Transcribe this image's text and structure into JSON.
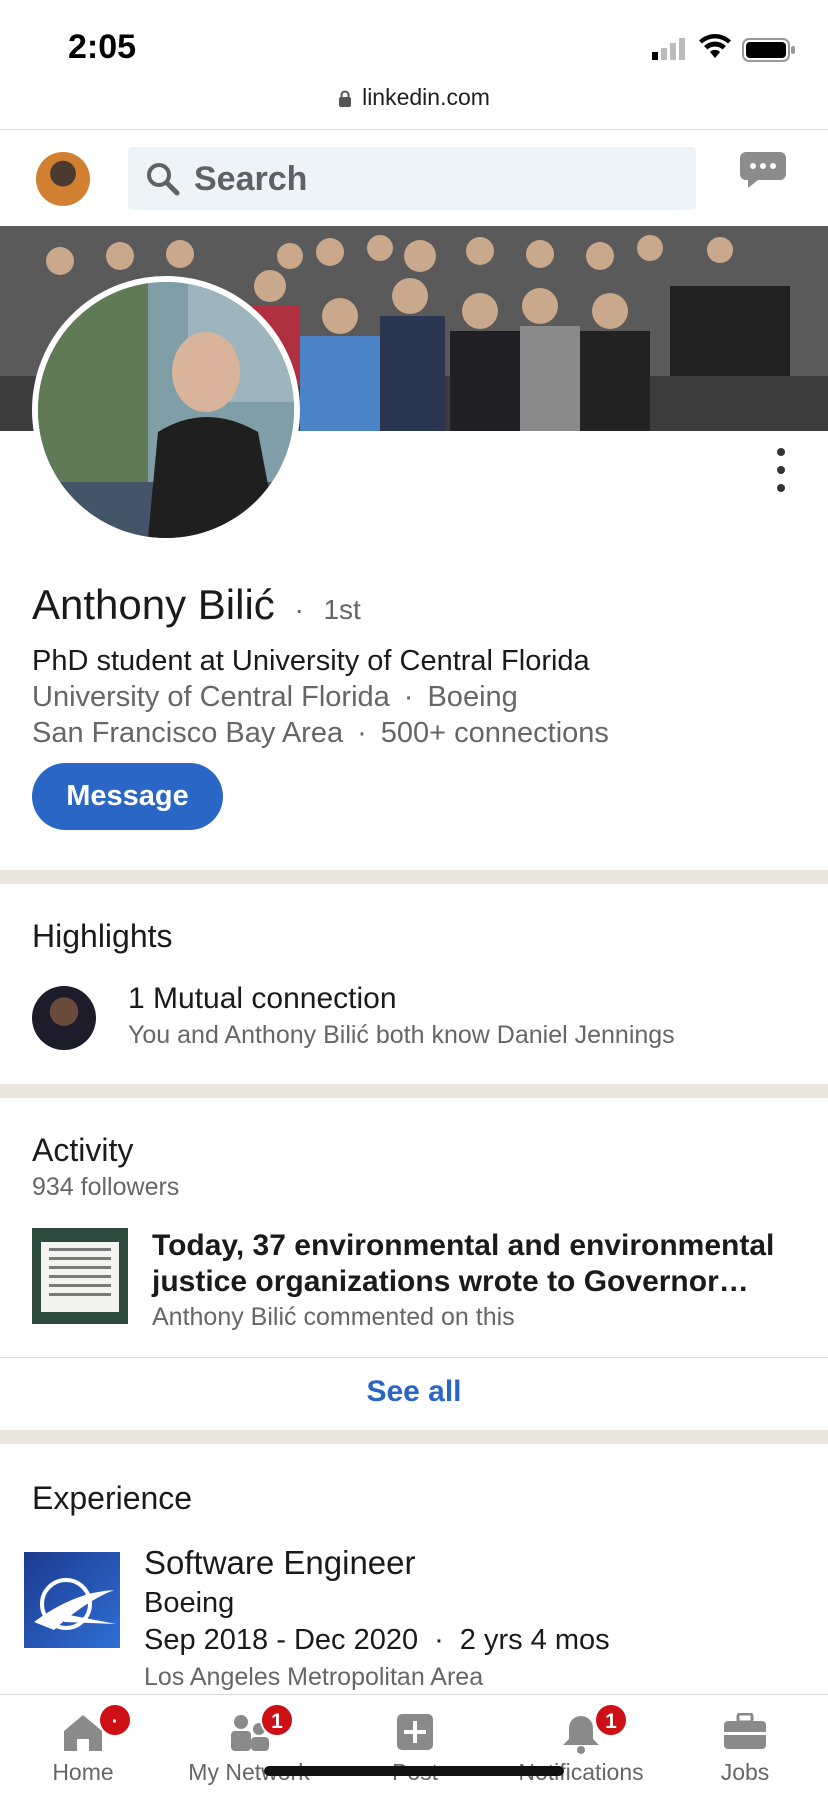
{
  "status_bar": {
    "time": "2:05",
    "url": "linkedin.com"
  },
  "top_nav": {
    "search_placeholder": "Search"
  },
  "profile": {
    "name": "Anthony Bilić",
    "degree_separator": "·",
    "degree": "1st",
    "headline": "PhD student at University of Central Florida",
    "education": "University of Central Florida",
    "company": "Boeing",
    "location": "San Francisco Bay Area",
    "connections": "500+ connections",
    "dot": "·",
    "message_button": "Message"
  },
  "highlights": {
    "title": "Highlights",
    "mutual_title": "1 Mutual connection",
    "mutual_sub": "You and Anthony Bilić both know Daniel Jennings"
  },
  "activity": {
    "title": "Activity",
    "followers": "934 followers",
    "post_title": "Today, 37 environmental and environmental justice organizations wrote to Governor…",
    "post_sub": "Anthony Bilić commented on this",
    "see_all": "See all"
  },
  "experience": {
    "title": "Experience",
    "role": "Software Engineer",
    "company": "Boeing",
    "dates": "Sep 2018 - Dec 2020",
    "duration": "2 yrs 4 mos",
    "location": "Los Angeles Metropolitan Area"
  },
  "tabs": [
    {
      "label": "Home",
      "badge": "·"
    },
    {
      "label": "My Network",
      "badge": "1"
    },
    {
      "label": "Post",
      "badge": ""
    },
    {
      "label": "Notifications",
      "badge": "1"
    },
    {
      "label": "Jobs",
      "badge": ""
    }
  ],
  "colors": {
    "accent": "#2a66c6",
    "badge": "#cc1016",
    "separator": "#ebe7df"
  }
}
